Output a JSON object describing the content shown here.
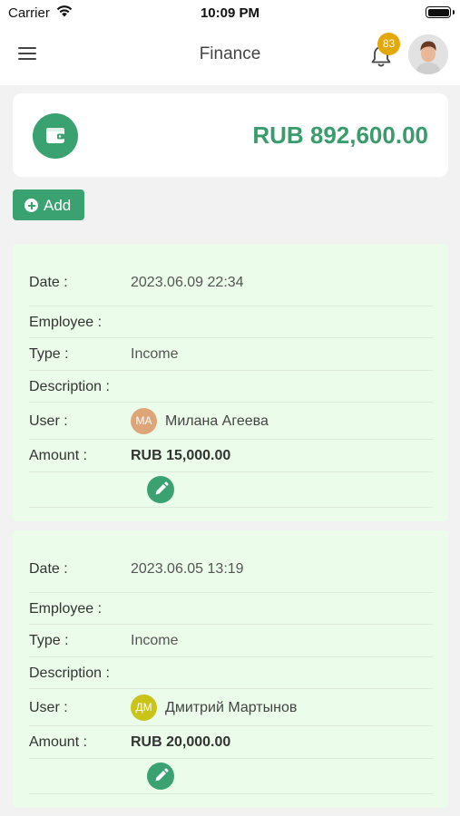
{
  "status_bar": {
    "carrier": "Carrier",
    "time": "10:09 PM"
  },
  "header": {
    "title": "Finance",
    "notification_count": "83"
  },
  "balance": {
    "amount": "RUB 892,600.00"
  },
  "actions": {
    "add_label": "Add"
  },
  "labels": {
    "date": "Date :",
    "employee": "Employee :",
    "type": "Type :",
    "description": "Description :",
    "user": "User :",
    "amount": "Amount :"
  },
  "transactions": [
    {
      "date": "2023.06.09 22:34",
      "employee": "",
      "type": "Income",
      "description": "",
      "user_initials": "МА",
      "user_name": "Милана Агеева",
      "user_color": "#dda578",
      "amount": "RUB 15,000.00"
    },
    {
      "date": "2023.06.05 13:19",
      "employee": "",
      "type": "Income",
      "description": "",
      "user_initials": "ДМ",
      "user_name": "Дмитрий Мартынов",
      "user_color": "#c9c31a",
      "amount": "RUB 20,000.00"
    }
  ],
  "colors": {
    "accent": "#3aa271",
    "badge": "#e4a80a",
    "card_bg": "#ebfcea"
  }
}
